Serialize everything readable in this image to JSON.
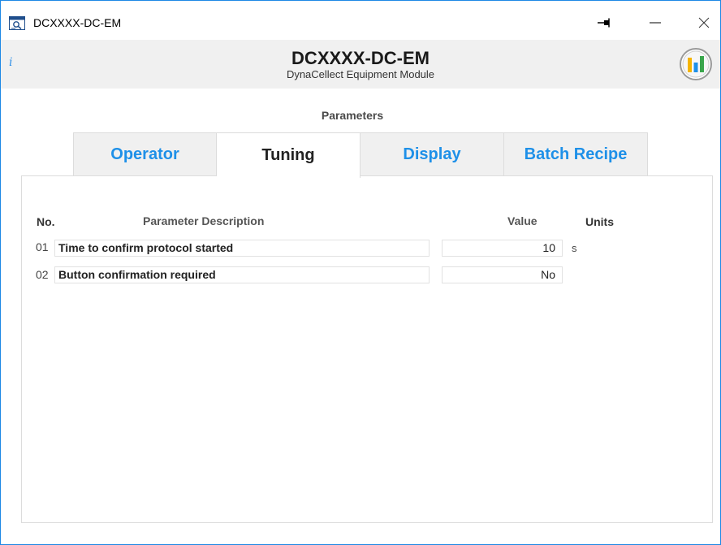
{
  "window": {
    "title": "DCXXXX-DC-EM"
  },
  "header": {
    "title": "DCXXXX-DC-EM",
    "subtitle": "DynaCellect Equipment Module",
    "info_icon": "i"
  },
  "section": {
    "label": "Parameters"
  },
  "tabs": [
    {
      "label": "Operator",
      "active": false
    },
    {
      "label": "Tuning",
      "active": true
    },
    {
      "label": "Display",
      "active": false
    },
    {
      "label": "Batch Recipe",
      "active": false
    }
  ],
  "table": {
    "headers": {
      "no": "No.",
      "description": "Parameter Description",
      "value": "Value",
      "units": "Units"
    },
    "rows": [
      {
        "no": "01",
        "description": "Time to confirm protocol started",
        "value": "10",
        "unit": "s"
      },
      {
        "no": "02",
        "description": "Button confirmation required",
        "value": "No",
        "unit": ""
      }
    ]
  },
  "colors": {
    "accent": "#1e90e8",
    "window_border": "#1e88e5",
    "header_bg": "#f0f0f0"
  },
  "icons": {
    "app": "app-icon",
    "pin": "pin-icon",
    "minimize": "minimize-icon",
    "close": "close-icon",
    "info": "info-icon",
    "chart": "bar-chart-icon"
  }
}
